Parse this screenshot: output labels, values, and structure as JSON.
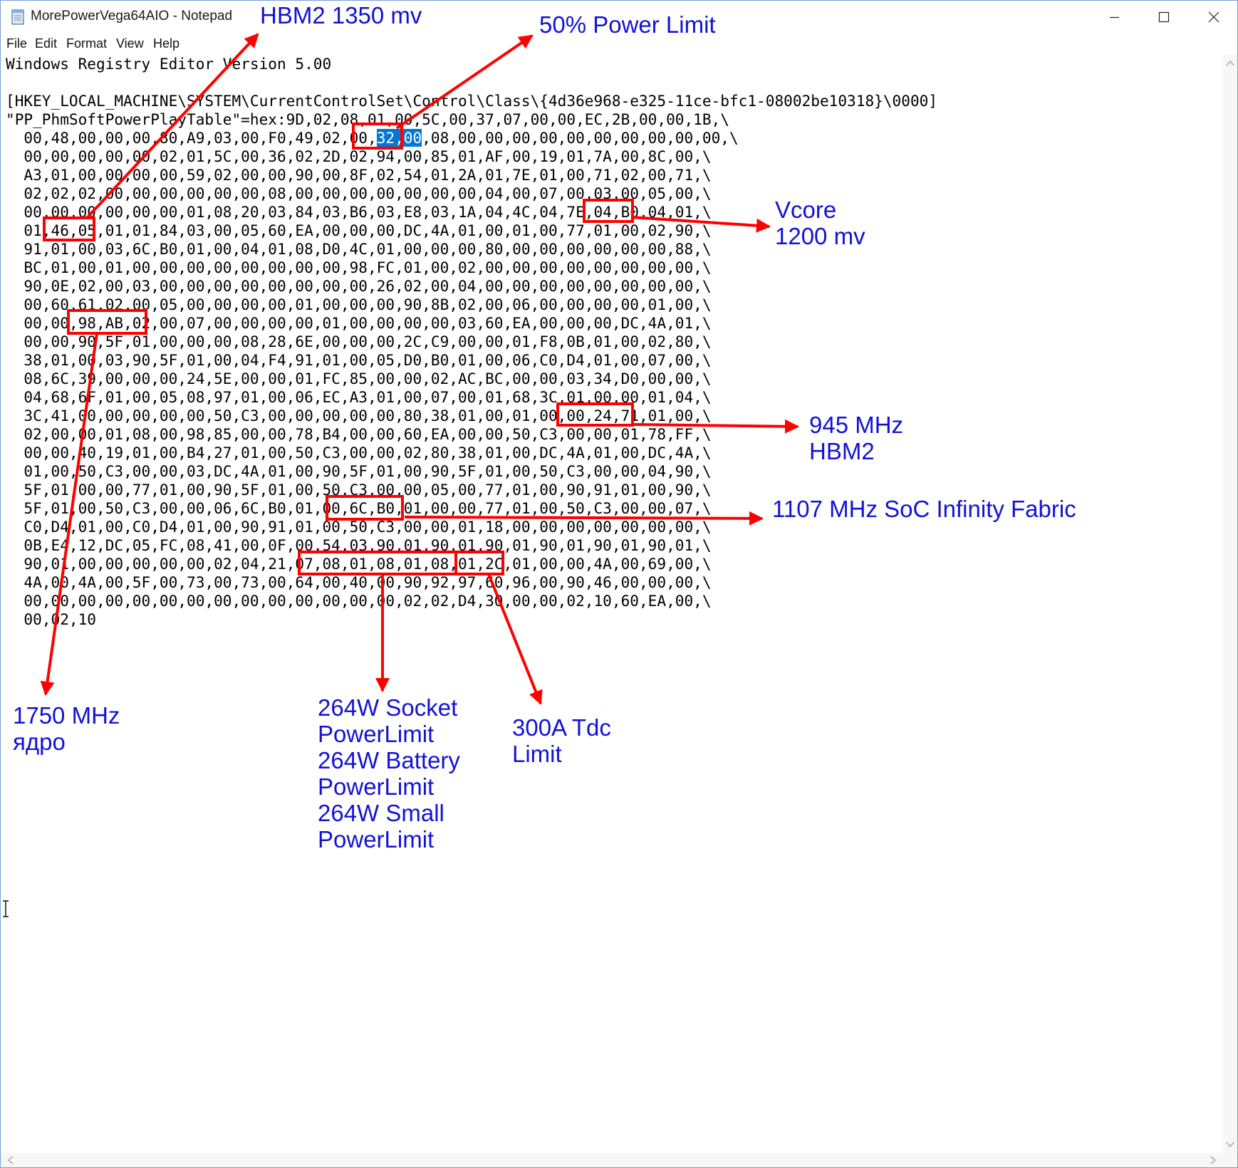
{
  "window": {
    "title": "MorePowerVega64AIO - Notepad",
    "icons": [
      "notepad-icon",
      "minimize-icon",
      "maximize-icon",
      "close-icon"
    ]
  },
  "menu": {
    "file": "File",
    "edit": "Edit",
    "format": "Format",
    "view": "View",
    "help": "Help"
  },
  "editor": {
    "lines": [
      "Windows Registry Editor Version 5.00",
      "",
      "[HKEY_LOCAL_MACHINE\\SYSTEM\\CurrentControlSet\\Control\\Class\\{4d36e968-e325-11ce-bfc1-08002be10318}\\0000]",
      "\"PP_PhmSoftPowerPlayTable\"=hex:9D,02,08,01,00,5C,00,37,07,00,00,EC,2B,00,00,1B,\\",
      "  00,48,00,00,00,80,A9,03,00,F0,49,02,00,32,00,08,00,00,00,00,00,00,00,00,00,00,\\",
      "  00,00,00,00,00,02,01,5C,00,36,02,2D,02,94,00,85,01,AF,00,19,01,7A,00,8C,00,\\",
      "  A3,01,00,00,00,00,59,02,00,00,90,00,8F,02,54,01,2A,01,7E,01,00,71,02,00,71,\\",
      "  02,02,02,00,00,00,00,00,00,08,00,00,00,00,00,00,00,04,00,07,00,03,00,05,00,\\",
      "  00,00,00,00,00,00,01,08,20,03,84,03,B6,03,E8,03,1A,04,4C,04,7E,04,B0,04,01,\\",
      "  01,46,05,01,01,84,03,00,05,60,EA,00,00,00,DC,4A,01,00,01,00,77,01,00,02,90,\\",
      "  91,01,00,03,6C,B0,01,00,04,01,08,D0,4C,01,00,00,00,80,00,00,00,00,00,00,88,\\",
      "  BC,01,00,01,00,00,00,00,00,00,00,00,98,FC,01,00,02,00,00,00,00,00,00,00,00,\\",
      "  90,0E,02,00,03,00,00,00,00,00,00,00,00,26,02,00,04,00,00,00,00,00,00,00,00,\\",
      "  00,60,61,02,00,05,00,00,00,00,01,00,00,00,90,8B,02,00,06,00,00,00,00,01,00,\\",
      "  00,00,98,AB,02,00,07,00,00,00,00,01,00,00,00,00,03,60,EA,00,00,00,DC,4A,01,\\",
      "  00,00,90,5F,01,00,00,00,08,28,6E,00,00,00,2C,C9,00,00,01,F8,0B,01,00,02,80,\\",
      "  38,01,00,03,90,5F,01,00,04,F4,91,01,00,05,D0,B0,01,00,06,C0,D4,01,00,07,00,\\",
      "  08,6C,39,00,00,00,24,5E,00,00,01,FC,85,00,00,02,AC,BC,00,00,03,34,D0,00,00,\\",
      "  04,68,6F,01,00,05,08,97,01,00,06,EC,A3,01,00,07,00,01,68,3C,01,00,00,01,04,\\",
      "  3C,41,00,00,00,00,00,50,C3,00,00,00,00,00,80,38,01,00,01,00,00,24,71,01,00,\\",
      "  02,00,00,01,08,00,98,85,00,00,78,B4,00,00,60,EA,00,00,50,C3,00,00,01,78,FF,\\",
      "  00,00,40,19,01,00,B4,27,01,00,50,C3,00,00,02,80,38,01,00,DC,4A,01,00,DC,4A,\\",
      "  01,00,50,C3,00,00,03,DC,4A,01,00,90,5F,01,00,90,5F,01,00,50,C3,00,00,04,90,\\",
      "  5F,01,00,00,77,01,00,90,5F,01,00,50,C3,00,00,05,00,77,01,00,90,91,01,00,90,\\",
      "  5F,01,00,50,C3,00,00,06,6C,B0,01,00,6C,B0,01,00,00,77,01,00,50,C3,00,00,07,\\",
      "  C0,D4,01,00,C0,D4,01,00,90,91,01,00,50,C3,00,00,01,18,00,00,00,00,00,00,00,\\",
      "  0B,E4,12,DC,05,FC,08,41,00,0F,00,54,03,90,01,90,01,90,01,90,01,90,01,90,01,\\",
      "  90,01,00,00,00,00,00,02,04,21,07,08,01,08,01,08,01,2C,01,00,00,4A,00,69,00,\\",
      "  4A,00,4A,00,5F,00,73,00,73,00,64,00,40,00,90,92,97,60,96,00,90,46,00,00,00,\\",
      "  00,00,00,00,00,00,00,00,00,00,00,00,00,00,02,02,D4,30,00,00,02,10,60,EA,00,\\",
      "  00,02,10"
    ]
  },
  "selection": {
    "line": 4,
    "text": "32,00"
  },
  "annotations": {
    "hbm2_voltage": "HBM2 1350 mv",
    "power_limit": "50% Power Limit",
    "vcore": [
      "Vcore",
      "1200 mv"
    ],
    "hbm2_clock": [
      "945 MHz",
      "HBM2"
    ],
    "soc_clock": "1107 MHz SoC Infinity Fabric",
    "core_clock": [
      "1750 MHz",
      "ядро"
    ],
    "power_limits": [
      "264W Socket",
      "PowerLimit",
      "264W Battery",
      "PowerLimit",
      "264W Small",
      "PowerLimit"
    ],
    "tdc_limit": [
      "300A Tdc",
      "Limit"
    ]
  },
  "colors": {
    "annotation_text": "#1212d6",
    "annotation_box": "#ff0000",
    "selection": "#0078d7"
  }
}
